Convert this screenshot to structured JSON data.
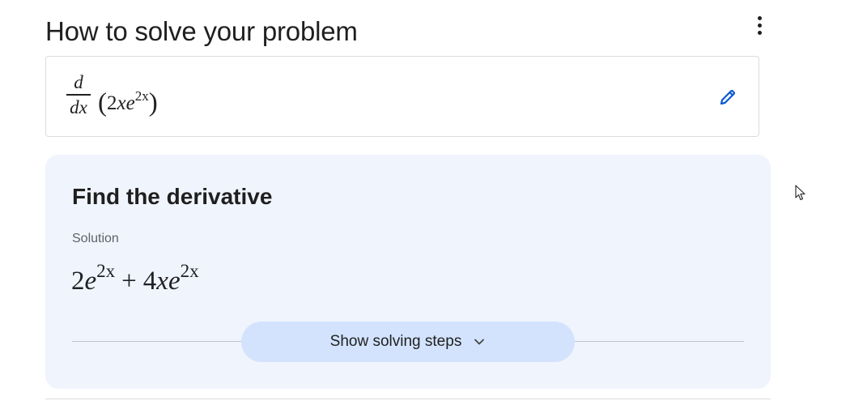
{
  "header": {
    "title": "How to solve your problem"
  },
  "problem": {
    "frac_num": "d",
    "frac_den": "dx",
    "open_paren": "(",
    "close_paren": ")",
    "coef": "2",
    "var": "x",
    "base": "e",
    "exponent": "2x"
  },
  "solution_card": {
    "title": "Find the derivative",
    "label": "Solution",
    "term1_coef": "2",
    "term1_base": "e",
    "term1_exp": "2x",
    "operator": "+",
    "term2_coef": "4",
    "term2_var": "x",
    "term2_base": "e",
    "term2_exp": "2x",
    "steps_button": "Show solving steps"
  },
  "icons": {
    "more": "more-vert-icon",
    "edit": "pencil-icon",
    "expand": "chevron-down-icon",
    "cursor": "mouse-cursor-icon"
  },
  "colors": {
    "accent": "#0b57d0",
    "card_bg": "#f0f4fd",
    "button_bg": "#d3e3fd"
  }
}
